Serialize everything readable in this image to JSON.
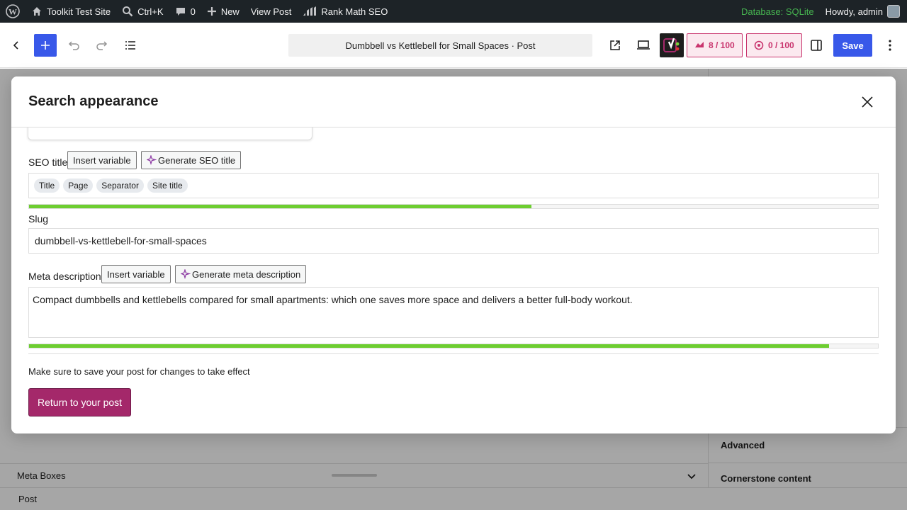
{
  "admin_bar": {
    "site_name": "Toolkit Test Site",
    "search_shortcut": "Ctrl+K",
    "comments_count": "0",
    "new_label": "New",
    "view_post": "View Post",
    "rank_math": "Rank Math SEO",
    "database": "Database: SQLite",
    "howdy": "Howdy, admin"
  },
  "toolbar": {
    "document_title": "Dumbbell vs Kettlebell for Small Spaces · Post",
    "score_readability": "8 / 100",
    "score_seo": "0 / 100",
    "save_label": "Save"
  },
  "sidebar": {
    "advanced": "Advanced",
    "cornerstone": "Cornerstone content"
  },
  "bottom": {
    "meta_boxes": "Meta Boxes",
    "footer_post": "Post"
  },
  "modal": {
    "title": "Search appearance",
    "seo_title_label": "SEO title",
    "insert_variable": "Insert variable",
    "generate_seo_title": "Generate SEO title",
    "seo_title_pills": [
      "Title",
      "Page",
      "Separator",
      "Site title"
    ],
    "seo_title_progress": 0.592,
    "slug_label": "Slug",
    "slug_value": "dumbbell-vs-kettlebell-for-small-spaces",
    "meta_label": "Meta description",
    "generate_meta": "Generate meta description",
    "meta_value": "Compact dumbbells and kettlebells compared for small apartments: which one saves more space and delivers a better full-body workout.",
    "meta_progress": 0.942,
    "note": "Make sure to save your post for changes to take effect",
    "return_label": "Return to your post"
  },
  "colors": {
    "admin_bar_bg": "#1d2327",
    "accent_blue": "#3858e9",
    "progress_green": "#6dce30",
    "return_button": "#a4286a",
    "score_red": "#c9356e"
  }
}
